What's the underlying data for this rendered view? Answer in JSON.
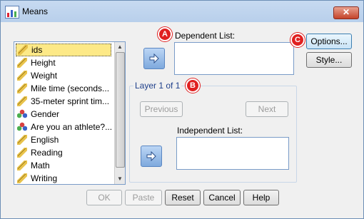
{
  "window": {
    "title": "Means",
    "close_glyph": "✕"
  },
  "variables": [
    {
      "label": "ids",
      "icon": "ruler-icon",
      "selected": true
    },
    {
      "label": "Height",
      "icon": "ruler-icon"
    },
    {
      "label": "Weight",
      "icon": "ruler-icon"
    },
    {
      "label": "Mile time (seconds...",
      "icon": "ruler-icon"
    },
    {
      "label": "35-meter sprint tim...",
      "icon": "ruler-icon"
    },
    {
      "label": "Gender",
      "icon": "nominal-icon"
    },
    {
      "label": "Are you an athlete?...",
      "icon": "nominal-icon"
    },
    {
      "label": "English",
      "icon": "ruler-icon"
    },
    {
      "label": "Reading",
      "icon": "ruler-icon"
    },
    {
      "label": "Math",
      "icon": "ruler-icon"
    },
    {
      "label": "Writing",
      "icon": "ruler-icon"
    }
  ],
  "dependent": {
    "label": "Dependent List:"
  },
  "layer": {
    "title": "Layer 1 of 1",
    "previous": "Previous",
    "next": "Next"
  },
  "independent": {
    "label": "Independent List:"
  },
  "side_buttons": {
    "options": "Options...",
    "style": "Style..."
  },
  "bottom_buttons": {
    "ok": "OK",
    "paste": "Paste",
    "reset": "Reset",
    "cancel": "Cancel",
    "help": "Help"
  },
  "annotations": {
    "a": "A",
    "b": "B",
    "c": "C"
  },
  "colors": {
    "annotation": "#e02020",
    "selection": "#fde987",
    "group_title": "#1e3f8a"
  }
}
